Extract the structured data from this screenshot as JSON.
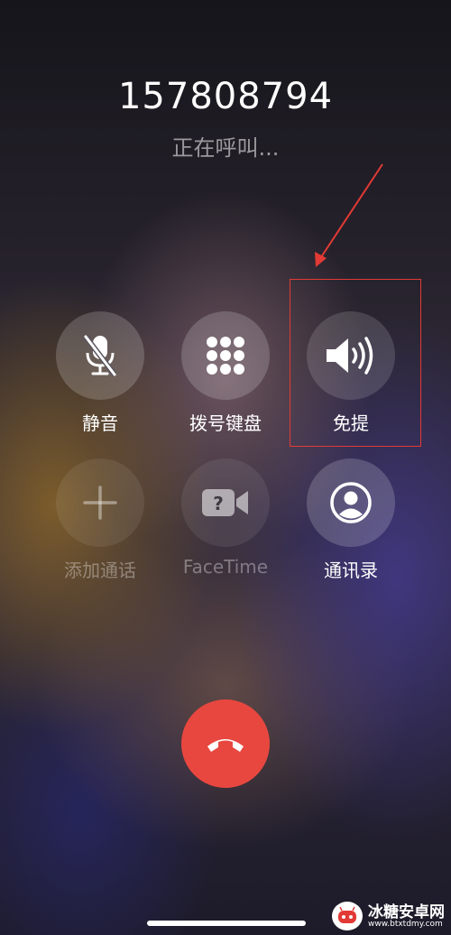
{
  "call": {
    "number": "157808794",
    "status": "正在呼叫..."
  },
  "controls": [
    {
      "label": "静音",
      "icon": "mic-muted-icon",
      "enabled": true
    },
    {
      "label": "拨号键盘",
      "icon": "keypad-icon",
      "enabled": true
    },
    {
      "label": "免提",
      "icon": "speaker-icon",
      "enabled": true,
      "highlighted": true
    },
    {
      "label": "添加通话",
      "icon": "plus-icon",
      "enabled": false
    },
    {
      "label": "FaceTime",
      "icon": "facetime-icon",
      "enabled": false
    },
    {
      "label": "通讯录",
      "icon": "contacts-icon",
      "enabled": true
    }
  ],
  "end_call": {
    "icon": "phone-hangup-icon",
    "color": "#e8473f"
  },
  "annotation": {
    "color": "#e23a35"
  },
  "watermark": {
    "title": "冰糖安卓网",
    "url": "www.btxtdmy.com"
  }
}
